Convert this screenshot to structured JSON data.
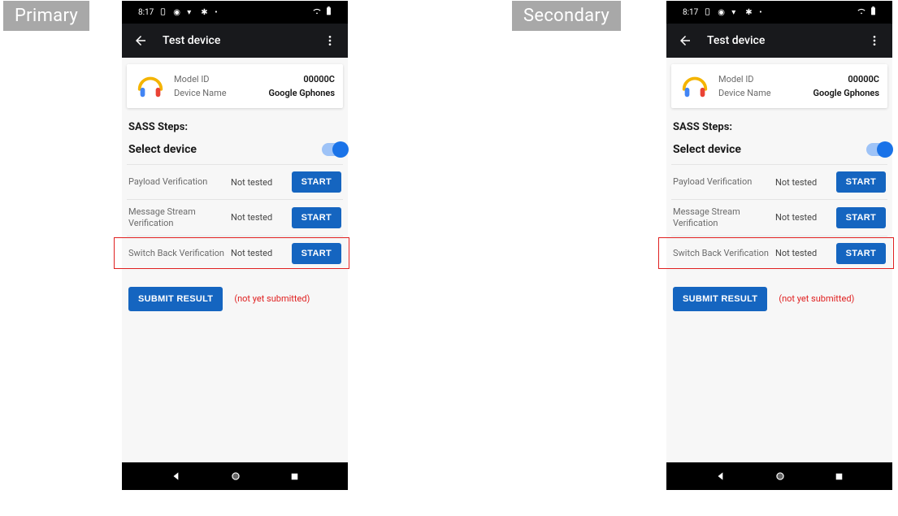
{
  "labels": {
    "primary": "Primary",
    "secondary": "Secondary"
  },
  "status": {
    "time": "8:17"
  },
  "appbar": {
    "title": "Test device"
  },
  "device": {
    "modelIdLabel": "Model ID",
    "modelId": "00000C",
    "nameLabel": "Device Name",
    "name": "Google Gphones"
  },
  "sass": {
    "heading": "SASS Steps:",
    "selectLabel": "Select device",
    "tests": [
      {
        "name": "Payload Verification",
        "status": "Not tested",
        "action": "START"
      },
      {
        "name": "Message Stream Verification",
        "status": "Not tested",
        "action": "START"
      },
      {
        "name": "Switch Back Verification",
        "status": "Not tested",
        "action": "START"
      }
    ],
    "submitLabel": "SUBMIT RESULT",
    "submitNote": "(not yet submitted)"
  }
}
